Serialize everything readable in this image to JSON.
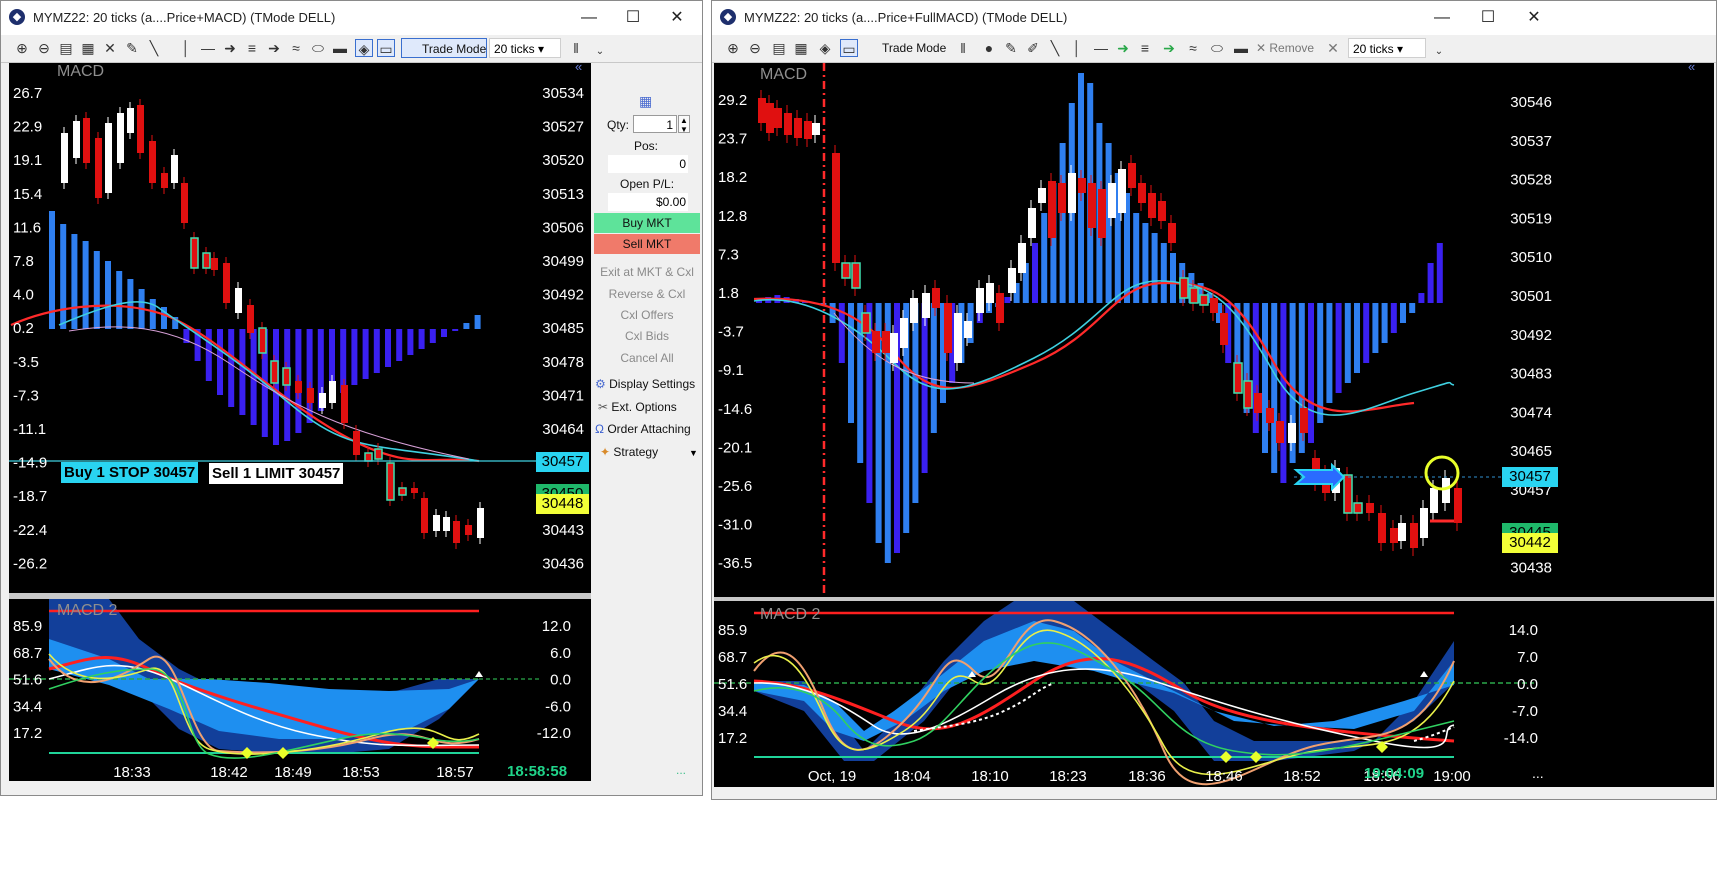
{
  "left_window": {
    "title": "MYMZ22: 20 ticks (a....Price+MACD) (TMode DELL)",
    "window_controls": {
      "minimize": "—",
      "maximize": "☐",
      "close": "✕"
    },
    "toolbar": {
      "trade_mode": "Trade Mode",
      "interval": "20 ticks"
    },
    "chart": {
      "panel_title": "MACD",
      "y_left": [
        "26.7",
        "22.9",
        "19.1",
        "15.4",
        "11.6",
        "7.8",
        "4.0",
        "0.2",
        "-3.5",
        "-7.3",
        "-11.1",
        "-14.9",
        "-18.7",
        "-22.4",
        "-26.2"
      ],
      "y_right": [
        "30534",
        "30527",
        "30520",
        "30513",
        "30506",
        "30499",
        "30492",
        "30485",
        "30478",
        "30471",
        "30464",
        "30457",
        "30450",
        "30443",
        "30436"
      ],
      "order_buy": "Buy 1 STOP 30457",
      "order_sell": "Sell 1 LIMIT 30457",
      "price_tag_cyan": "30457",
      "price_tag_yellow": "30448",
      "price_tag_green": "30450"
    },
    "macd2": {
      "panel_title": "MACD 2",
      "y_left": [
        "85.9",
        "68.7",
        "51.6",
        "34.4",
        "17.2"
      ],
      "y_right": [
        "12.0",
        "6.0",
        "0.0",
        "-6.0",
        "-12.0"
      ],
      "x_labels": [
        "18:33",
        "18:42",
        "18:49",
        "18:53",
        "18:57"
      ],
      "clock": "18:58:58"
    },
    "order_panel": {
      "qty_label": "Qty:",
      "qty_value": "1",
      "pos_label": "Pos:",
      "pos_value": "0",
      "pl_label": "Open P/L:",
      "pl_value": "$0.00",
      "buy_mkt": "Buy MKT",
      "sell_mkt": "Sell MKT",
      "exit_mkt": "Exit at MKT & Cxl",
      "reverse": "Reverse & Cxl",
      "cxl_offers": "Cxl Offers",
      "cxl_bids": "Cxl Bids",
      "cancel_all": "Cancel All",
      "display_settings": "Display Settings",
      "ext_options": "Ext. Options",
      "order_attaching": "Order Attaching",
      "strategy": "Strategy",
      "dots": "..."
    },
    "colors": {
      "buy": "#5ee39a",
      "sell": "#f07a6a"
    }
  },
  "right_window": {
    "title": "MYMZ22: 20 ticks (a....Price+FullMACD) (TMode DELL)",
    "window_controls": {
      "minimize": "—",
      "maximize": "☐",
      "close": "✕"
    },
    "toolbar": {
      "trade_mode": "Trade Mode",
      "remove": "Remove",
      "interval": "20 ticks"
    },
    "chart": {
      "panel_title": "MACD",
      "y_left": [
        "29.2",
        "23.7",
        "18.2",
        "12.8",
        "7.3",
        "1.8",
        "-3.7",
        "-9.1",
        "-14.6",
        "-20.1",
        "-25.6",
        "-31.0",
        "-36.5"
      ],
      "y_right": [
        "30546",
        "30537",
        "30528",
        "30519",
        "30510",
        "30501",
        "30492",
        "30483",
        "30474",
        "30465",
        "30457",
        "30447",
        "30438"
      ],
      "price_tag_cyan": "30457",
      "price_tag_yellow": "30442",
      "price_tag_green": "30445"
    },
    "macd2": {
      "panel_title": "MACD 2",
      "y_left": [
        "85.9",
        "68.7",
        "51.6",
        "34.4",
        "17.2"
      ],
      "y_right": [
        "14.0",
        "7.0",
        "0.0",
        "-7.0",
        "-14.0"
      ],
      "x_labels": [
        "Oct, 19",
        "18:04",
        "18:10",
        "18:23",
        "18:36",
        "18:46",
        "18:52",
        "18:56",
        "19:00"
      ],
      "clock": "19:04:09",
      "dots": "..."
    }
  }
}
